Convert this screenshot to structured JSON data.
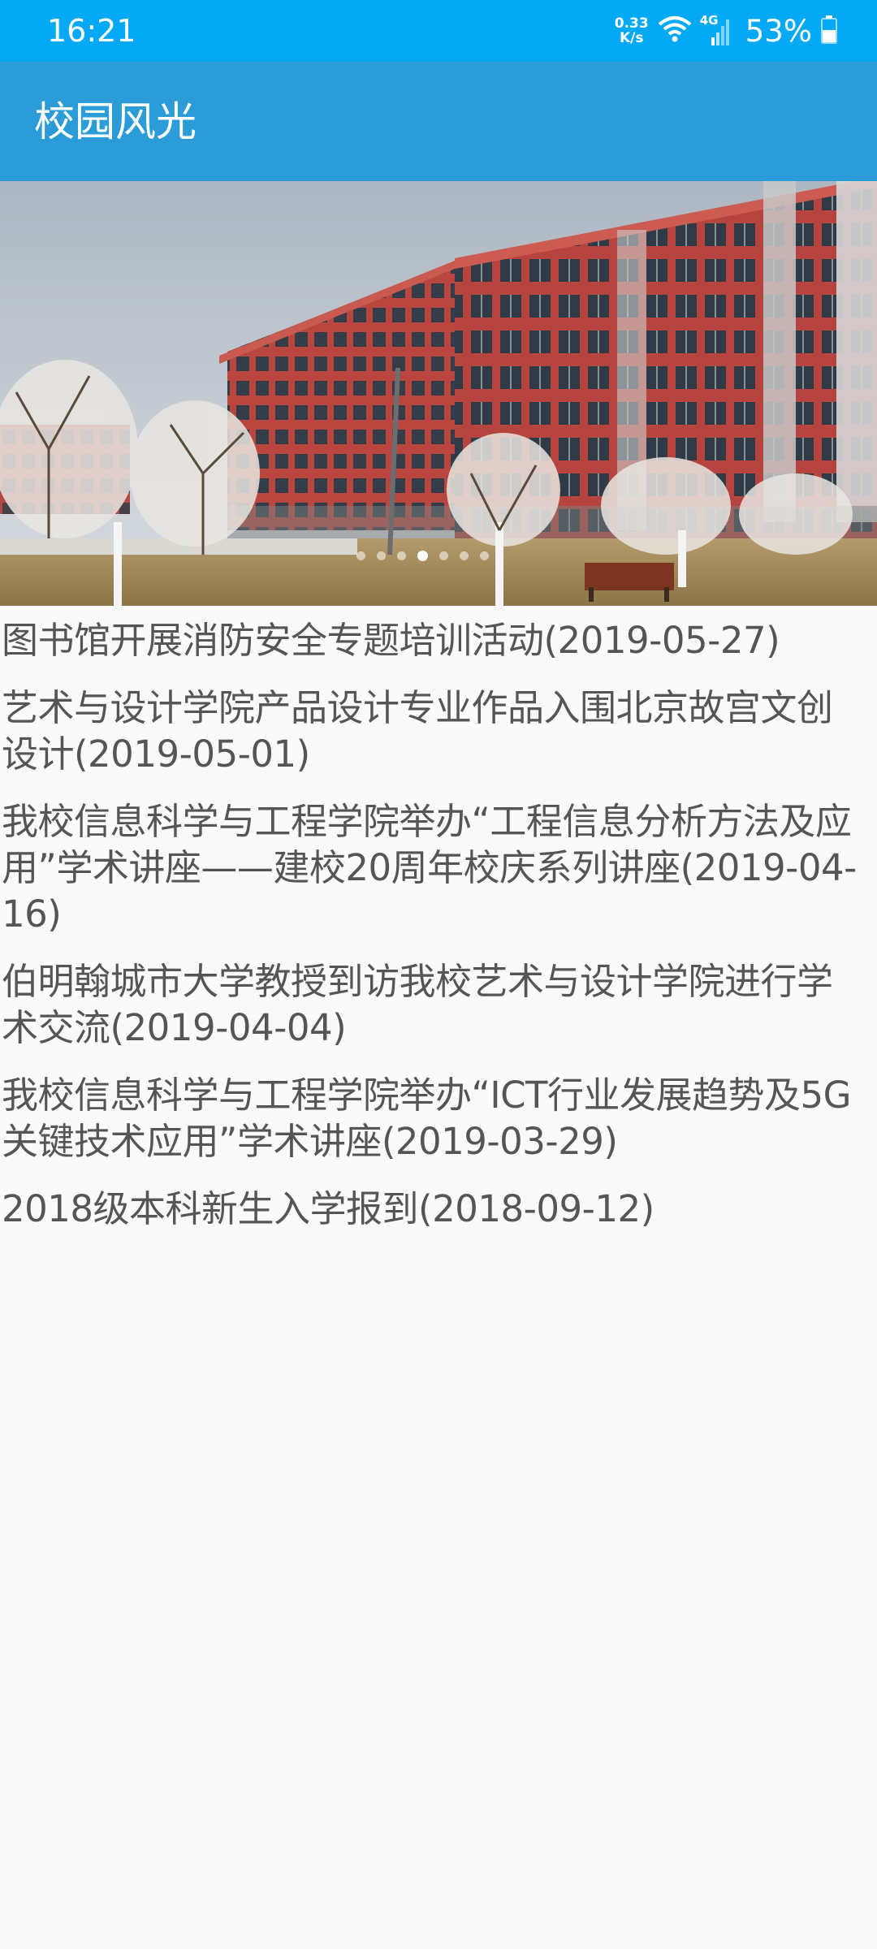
{
  "status_bar": {
    "time": "16:21",
    "net_speed_value": "0.33",
    "net_speed_unit": "K/s",
    "signal_type": "4G",
    "battery": "53%",
    "icons": [
      "wifi-icon",
      "cellular-signal-icon",
      "battery-icon"
    ]
  },
  "app_bar": {
    "title": "校园风光"
  },
  "banner": {
    "image": "campus-building-photo",
    "page_count": 7,
    "active_page": 4
  },
  "news": [
    {
      "text": "图书馆开展消防安全专题培训活动(2019-05-27)"
    },
    {
      "text": "艺术与设计学院产品设计专业作品入围北京故宫文创设计(2019-05-01)"
    },
    {
      "text": "我校信息科学与工程学院举办“工程信息分析方法及应用”学术讲座——建校20周年校庆系列讲座(2019-04-16)"
    },
    {
      "text": "伯明翰城市大学教授到访我校艺术与设计学院进行学术交流(2019-04-04)"
    },
    {
      "text": "我校信息科学与工程学院举办“ICT行业发展趋势及5G关键技术应用”学术讲座(2019-03-29)"
    },
    {
      "text": "2018级本科新生入学报到(2018-09-12)"
    }
  ],
  "colors": {
    "status_bar": "#03a9f4",
    "app_bar": "#2b9cd8",
    "background": "#fafafa",
    "text": "#555555"
  }
}
